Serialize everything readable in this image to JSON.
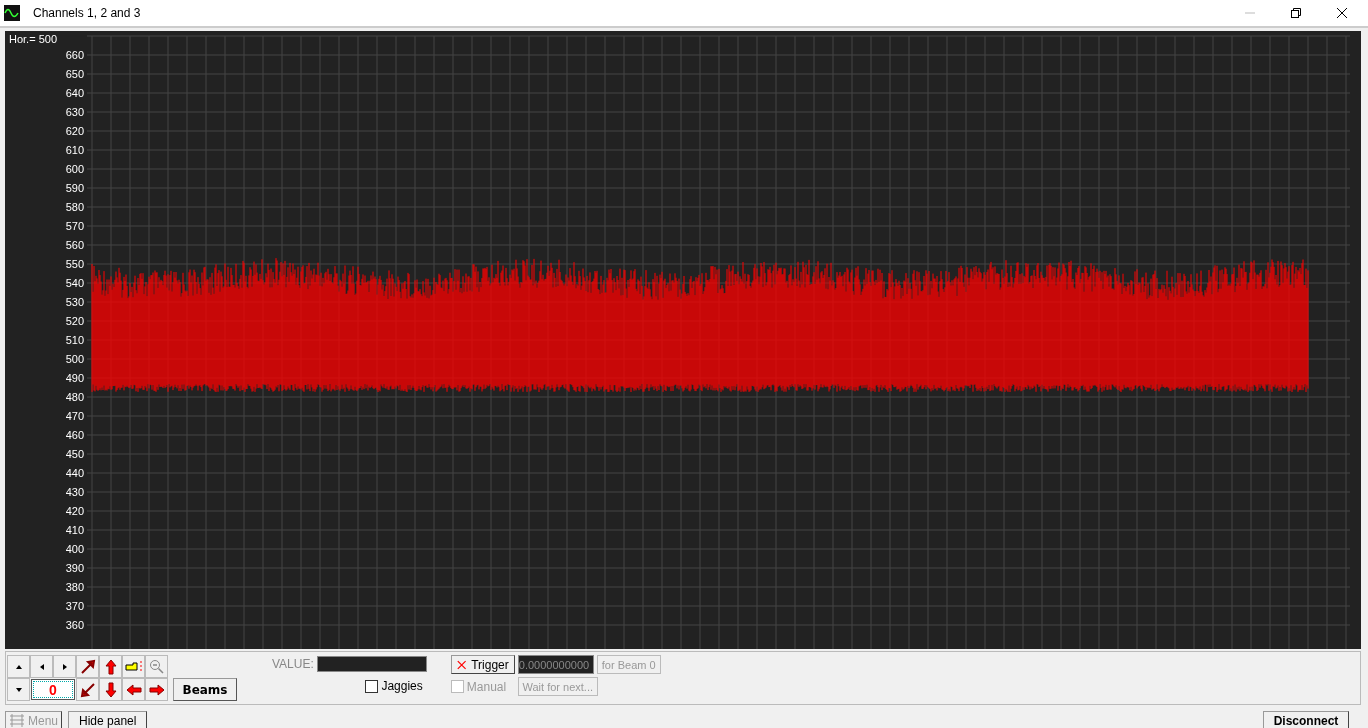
{
  "window": {
    "title": "Channels 1, 2 and 3"
  },
  "plot": {
    "header": "Hor.= 500",
    "y_labels": [
      "660",
      "650",
      "640",
      "630",
      "620",
      "610",
      "600",
      "590",
      "580",
      "570",
      "560",
      "550",
      "540",
      "530",
      "520",
      "510",
      "500",
      "490",
      "480",
      "470",
      "460",
      "450",
      "440",
      "430",
      "420",
      "410",
      "400",
      "390",
      "380",
      "370",
      "360"
    ]
  },
  "controls": {
    "beam_index": "0",
    "beams_button": "Beams",
    "value_label": "VALUE:",
    "jaggies": {
      "label": "Jaggies",
      "checked": false
    },
    "trigger": {
      "label": "Trigger",
      "value": "0.0000000000",
      "for_beam": {
        "label": "for Beam 0",
        "disabled": true
      },
      "manual": {
        "label": "Manual",
        "checked": false,
        "disabled": true
      },
      "wait": {
        "label": "Wait for next...",
        "disabled": true
      }
    }
  },
  "bottom_bar": {
    "menu": {
      "label": "Menu",
      "disabled": true
    },
    "hide_panel": "Hide panel",
    "disconnect": "Disconnect"
  }
}
